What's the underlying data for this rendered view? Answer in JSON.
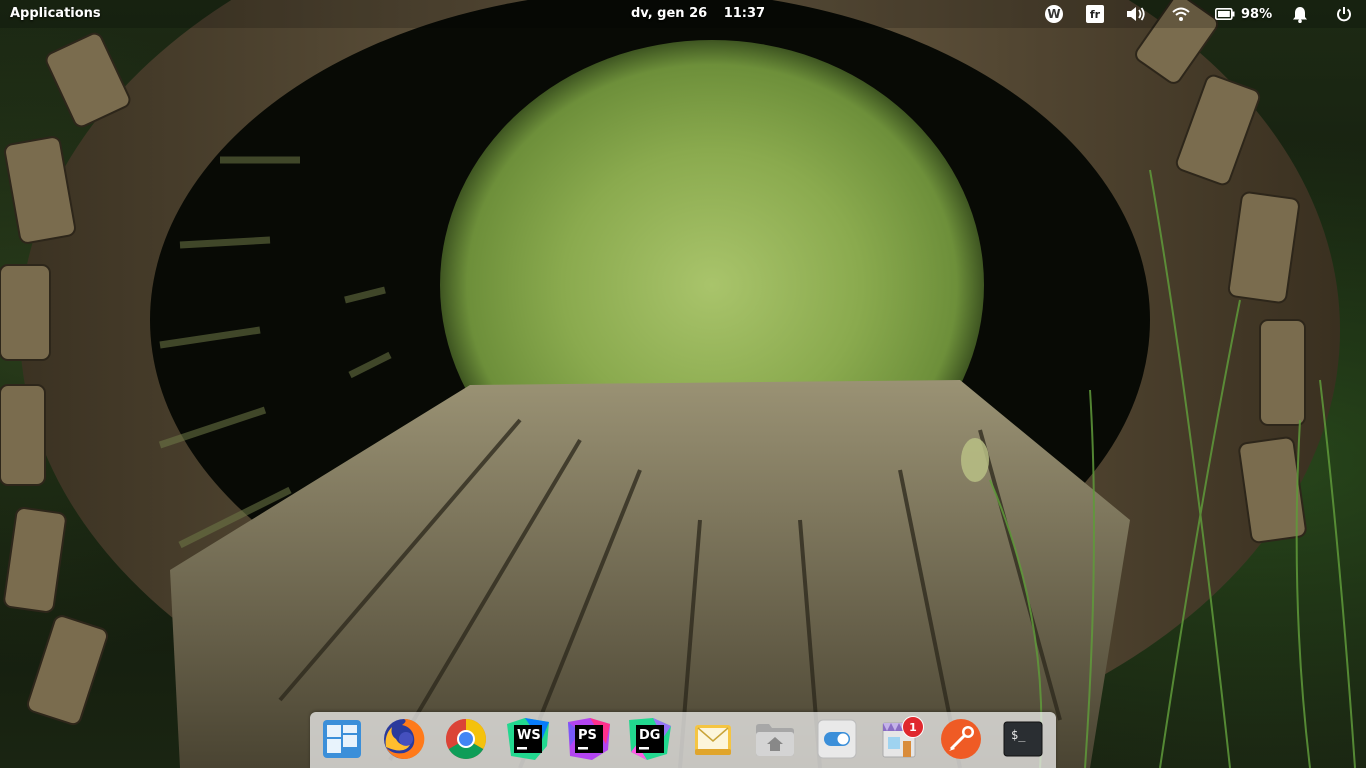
{
  "panel": {
    "applications_label": "Applications",
    "date": "dv, gen 26",
    "time": "11:37",
    "indicators": {
      "wingpanel_icon_letter": "W",
      "keyboard_layout": "fr",
      "battery_percent": "98%"
    }
  },
  "dock": {
    "items": [
      {
        "name": "multitasking-view",
        "icon": "multitasking-icon"
      },
      {
        "name": "firefox",
        "icon": "firefox-icon"
      },
      {
        "name": "chrome",
        "icon": "chrome-icon"
      },
      {
        "name": "webstorm",
        "icon": "webstorm-icon",
        "label": "WS"
      },
      {
        "name": "phpstorm",
        "icon": "phpstorm-icon",
        "label": "PS"
      },
      {
        "name": "datagrip",
        "icon": "datagrip-icon",
        "label": "DG"
      },
      {
        "name": "mail",
        "icon": "mail-icon"
      },
      {
        "name": "files",
        "icon": "files-icon"
      },
      {
        "name": "system-settings",
        "icon": "settings-icon"
      },
      {
        "name": "appcenter",
        "icon": "appcenter-icon",
        "badge": "1"
      },
      {
        "name": "postman",
        "icon": "postman-icon"
      },
      {
        "name": "terminal",
        "icon": "terminal-icon",
        "label": "$_"
      }
    ]
  },
  "colors": {
    "webstorm_accent": "#22d88f",
    "phpstorm_accent": "#b345f1",
    "datagrip_accent": "#22d88f",
    "badge_red": "#e0282e"
  }
}
